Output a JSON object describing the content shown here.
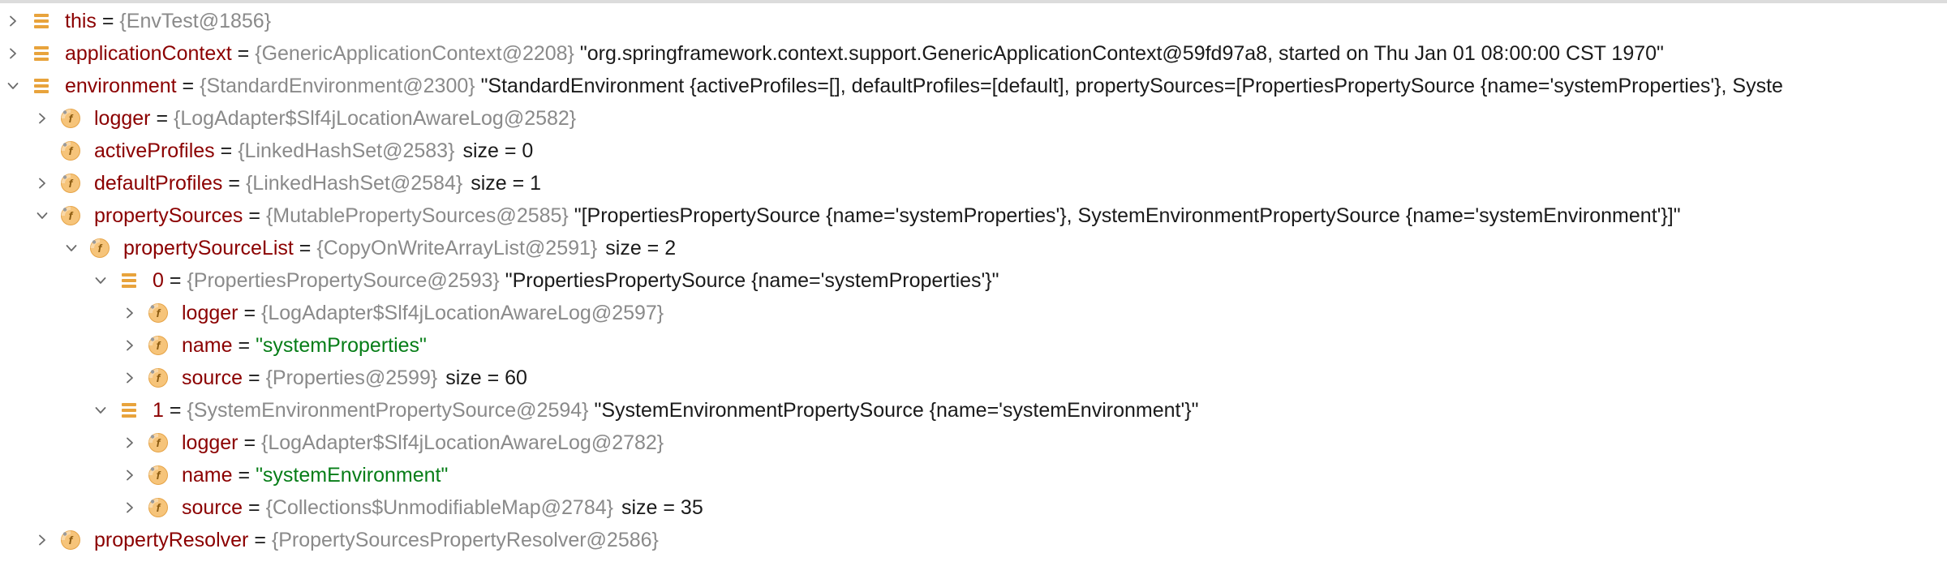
{
  "rows": [
    {
      "depth": 0,
      "chevron": "right",
      "icon": "field-list",
      "name": "this",
      "ref": "{EnvTest@1856}",
      "value": "",
      "value_kind": "",
      "size": ""
    },
    {
      "depth": 0,
      "chevron": "right",
      "icon": "field-list",
      "name": "applicationContext",
      "ref": "{GenericApplicationContext@2208}",
      "value": "\"org.springframework.context.support.GenericApplicationContext@59fd97a8, started on Thu Jan 01 08:00:00 CST 1970\"",
      "value_kind": "str",
      "size": ""
    },
    {
      "depth": 0,
      "chevron": "down",
      "icon": "field-list",
      "name": "environment",
      "ref": "{StandardEnvironment@2300}",
      "value": "\"StandardEnvironment {activeProfiles=[], defaultProfiles=[default], propertySources=[PropertiesPropertySource {name='systemProperties'}, Syste",
      "value_kind": "str",
      "size": ""
    },
    {
      "depth": 1,
      "chevron": "right",
      "icon": "field-f",
      "name": "logger",
      "ref": "{LogAdapter$Slf4jLocationAwareLog@2582}",
      "value": "",
      "value_kind": "",
      "size": ""
    },
    {
      "depth": 1,
      "chevron": "none",
      "icon": "field-f",
      "name": "activeProfiles",
      "ref": "{LinkedHashSet@2583}",
      "value": "",
      "value_kind": "",
      "size": "size = 0"
    },
    {
      "depth": 1,
      "chevron": "right",
      "icon": "field-f",
      "name": "defaultProfiles",
      "ref": "{LinkedHashSet@2584}",
      "value": "",
      "value_kind": "",
      "size": "size = 1"
    },
    {
      "depth": 1,
      "chevron": "down",
      "icon": "field-f",
      "name": "propertySources",
      "ref": "{MutablePropertySources@2585}",
      "value": "\"[PropertiesPropertySource {name='systemProperties'}, SystemEnvironmentPropertySource {name='systemEnvironment'}]\"",
      "value_kind": "str",
      "size": ""
    },
    {
      "depth": 2,
      "chevron": "down",
      "icon": "field-f",
      "name": "propertySourceList",
      "ref": "{CopyOnWriteArrayList@2591}",
      "value": "",
      "value_kind": "",
      "size": "size = 2"
    },
    {
      "depth": 3,
      "chevron": "down",
      "icon": "field-list",
      "name": "0",
      "ref": "{PropertiesPropertySource@2593}",
      "value": "\"PropertiesPropertySource {name='systemProperties'}\"",
      "value_kind": "str",
      "size": ""
    },
    {
      "depth": 4,
      "chevron": "right",
      "icon": "field-f",
      "name": "logger",
      "ref": "{LogAdapter$Slf4jLocationAwareLog@2597}",
      "value": "",
      "value_kind": "",
      "size": ""
    },
    {
      "depth": 4,
      "chevron": "right",
      "icon": "field-f",
      "name": "name",
      "ref": "",
      "value": "\"systemProperties\"",
      "value_kind": "strlit",
      "size": ""
    },
    {
      "depth": 4,
      "chevron": "right",
      "icon": "field-f",
      "name": "source",
      "ref": "{Properties@2599}",
      "value": "",
      "value_kind": "",
      "size": "size = 60"
    },
    {
      "depth": 3,
      "chevron": "down",
      "icon": "field-list",
      "name": "1",
      "ref": "{SystemEnvironmentPropertySource@2594}",
      "value": "\"SystemEnvironmentPropertySource {name='systemEnvironment'}\"",
      "value_kind": "str",
      "size": ""
    },
    {
      "depth": 4,
      "chevron": "right",
      "icon": "field-f",
      "name": "logger",
      "ref": "{LogAdapter$Slf4jLocationAwareLog@2782}",
      "value": "",
      "value_kind": "",
      "size": ""
    },
    {
      "depth": 4,
      "chevron": "right",
      "icon": "field-f",
      "name": "name",
      "ref": "",
      "value": "\"systemEnvironment\"",
      "value_kind": "strlit",
      "size": ""
    },
    {
      "depth": 4,
      "chevron": "right",
      "icon": "field-f",
      "name": "source",
      "ref": "{Collections$UnmodifiableMap@2784}",
      "value": "",
      "value_kind": "",
      "size": "size = 35"
    },
    {
      "depth": 1,
      "chevron": "right",
      "icon": "field-f",
      "name": "propertyResolver",
      "ref": "{PropertySourcesPropertyResolver@2586}",
      "value": "",
      "value_kind": "",
      "size": ""
    }
  ],
  "equals_sign": "=",
  "colors": {
    "name": "#8b0000",
    "ref": "#8a8a8a",
    "string_literal": "#067d17",
    "icon_orange": "#e8a33c",
    "icon_badge_bg": "#f6c47a"
  }
}
